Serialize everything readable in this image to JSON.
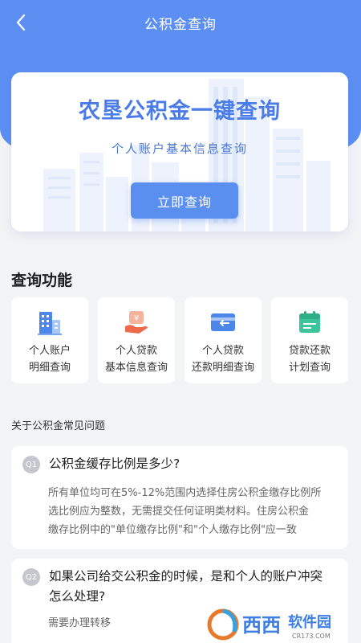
{
  "header": {
    "title": "公积金查询",
    "back_icon": "chevron-left-icon"
  },
  "hero": {
    "title": "农垦公积金一键查询",
    "subtitle": "个人账户基本信息查询",
    "button": "立即查询"
  },
  "features": {
    "title": "查询功能",
    "items": [
      {
        "line1": "个人账户",
        "line2": "明细查询",
        "icon": "building-icon"
      },
      {
        "line1": "个人贷款",
        "line2": "基本信息查询",
        "icon": "loan-coin-icon"
      },
      {
        "line1": "个人贷款",
        "line2": "还款明细查询",
        "icon": "card-return-icon"
      },
      {
        "line1": "贷款还款",
        "line2": "计划查询",
        "icon": "calendar-icon"
      }
    ]
  },
  "faq": {
    "title": "关于公积金常见问题",
    "items": [
      {
        "badge": "Q1",
        "question": "公积金缓存比例是多少?",
        "answer_lines": [
          "所有单位均可在5%-12%范围内选择住房公积金缴存比例所",
          "选比例应为整数，无需提交任何证明类材料。住房公积金",
          "缴存比例中的\"单位缴存比例\"和\"个人缴存比例\"应一致"
        ]
      },
      {
        "badge": "Q2",
        "question_lines": [
          "如果公司给交公积金的时候，是和个人的账户冲突",
          "怎么处理?"
        ],
        "answer": "需要办理转移"
      }
    ]
  },
  "watermark": {
    "brand": "西西",
    "text": "软件园",
    "url": "CR173.COM"
  },
  "colors": {
    "primary": "#5d8ff3",
    "button": "#5a8ff0",
    "background": "#f3f4f6"
  }
}
